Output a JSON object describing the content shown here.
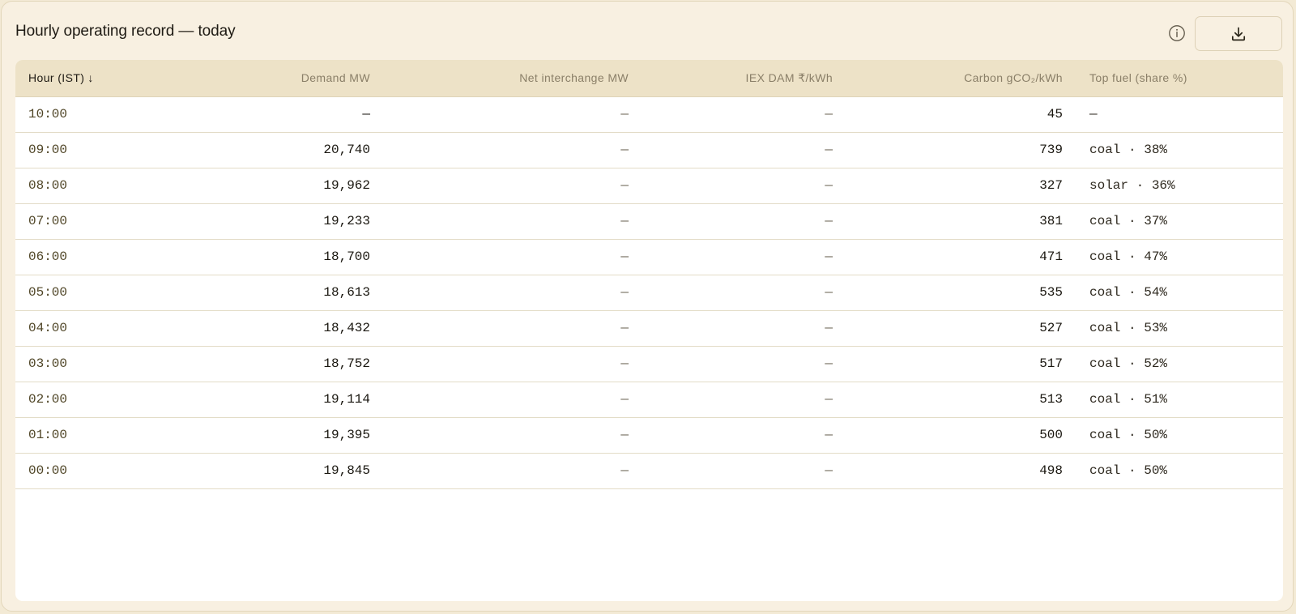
{
  "panel": {
    "title": "Hourly operating record — today",
    "info_icon": "info-circle-icon",
    "download_icon": "download-icon"
  },
  "table": {
    "headers": {
      "hour": "Hour (IST)",
      "hour_sort_arrow": "↓",
      "demand": "Demand MW",
      "net": "Net interchange MW",
      "iex": "IEX DAM ₹/kWh",
      "carbon": "Carbon gCO₂/kWh",
      "fuel": "Top fuel (share %)"
    },
    "rows": [
      {
        "hour": "10:00",
        "demand": "—",
        "net": "—",
        "iex": "—",
        "carbon": "45",
        "fuel": "—"
      },
      {
        "hour": "09:00",
        "demand": "20,740",
        "net": "—",
        "iex": "—",
        "carbon": "739",
        "fuel": "coal · 38%"
      },
      {
        "hour": "08:00",
        "demand": "19,962",
        "net": "—",
        "iex": "—",
        "carbon": "327",
        "fuel": "solar · 36%"
      },
      {
        "hour": "07:00",
        "demand": "19,233",
        "net": "—",
        "iex": "—",
        "carbon": "381",
        "fuel": "coal · 37%"
      },
      {
        "hour": "06:00",
        "demand": "18,700",
        "net": "—",
        "iex": "—",
        "carbon": "471",
        "fuel": "coal · 47%"
      },
      {
        "hour": "05:00",
        "demand": "18,613",
        "net": "—",
        "iex": "—",
        "carbon": "535",
        "fuel": "coal · 54%"
      },
      {
        "hour": "04:00",
        "demand": "18,432",
        "net": "—",
        "iex": "—",
        "carbon": "527",
        "fuel": "coal · 53%"
      },
      {
        "hour": "03:00",
        "demand": "18,752",
        "net": "—",
        "iex": "—",
        "carbon": "517",
        "fuel": "coal · 52%"
      },
      {
        "hour": "02:00",
        "demand": "19,114",
        "net": "—",
        "iex": "—",
        "carbon": "513",
        "fuel": "coal · 51%"
      },
      {
        "hour": "01:00",
        "demand": "19,395",
        "net": "—",
        "iex": "—",
        "carbon": "500",
        "fuel": "coal · 50%"
      },
      {
        "hour": "00:00",
        "demand": "19,845",
        "net": "—",
        "iex": "—",
        "carbon": "498",
        "fuel": "coal · 50%"
      }
    ]
  },
  "colors": {
    "page_background": "#f3ead5",
    "panel_background": "#f8f0e1",
    "header_row_background": "#ede2c7",
    "table_background": "#ffffff",
    "header_text": "#8a7f68",
    "sorted_header_text": "#1f1b14"
  }
}
